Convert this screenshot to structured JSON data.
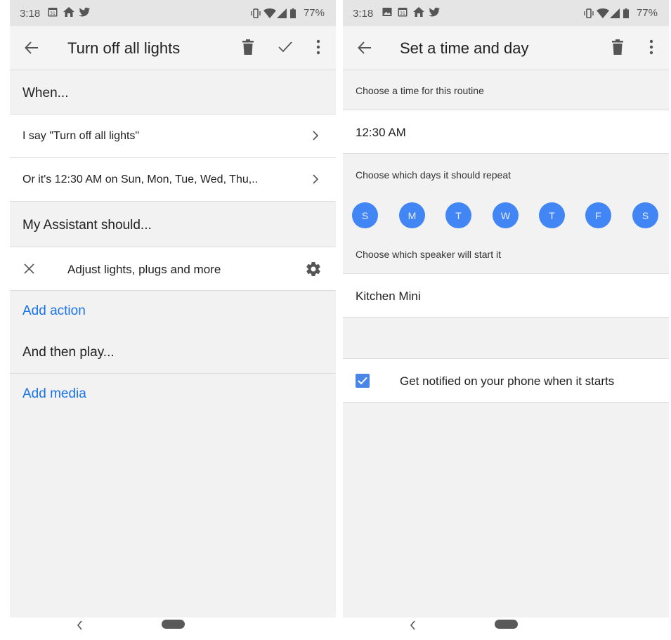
{
  "status_left": {
    "time": "3:18",
    "battery": "77%"
  },
  "status_right": {
    "time": "3:18",
    "battery": "77%"
  },
  "left": {
    "title": "Turn off all lights",
    "section_when": "When...",
    "trigger_voice": "I say \"Turn off all lights\"",
    "trigger_time": "Or it's 12:30 AM on Sun, Mon, Tue, Wed, Thu,..",
    "section_assistant": "My Assistant should...",
    "action_item": "Adjust lights, plugs and more",
    "add_action": "Add action",
    "section_play": "And then play...",
    "add_media": "Add media"
  },
  "right": {
    "title": "Set a time and day",
    "time_label": "Choose a time for this routine",
    "time_value": "12:30 AM",
    "days_label": "Choose which days it should repeat",
    "days": [
      "S",
      "M",
      "T",
      "W",
      "T",
      "F",
      "S"
    ],
    "speaker_label": "Choose which speaker will start it",
    "speaker_value": "Kitchen Mini",
    "notify_label": "Get notified on your phone when it starts",
    "notify_checked": true
  },
  "colors": {
    "accent": "#4285f4",
    "link": "#1a73e8",
    "checkbox": "#4a86e8"
  },
  "icons": [
    "calendar-icon",
    "home-icon",
    "twitter-icon",
    "image-icon",
    "vibrate-icon",
    "wifi-icon",
    "signal-icon",
    "battery-icon",
    "back-arrow-icon",
    "trash-icon",
    "check-icon",
    "more-vert-icon",
    "chevron-right-icon",
    "close-icon",
    "gear-icon",
    "nav-back-icon",
    "nav-home-pill"
  ]
}
